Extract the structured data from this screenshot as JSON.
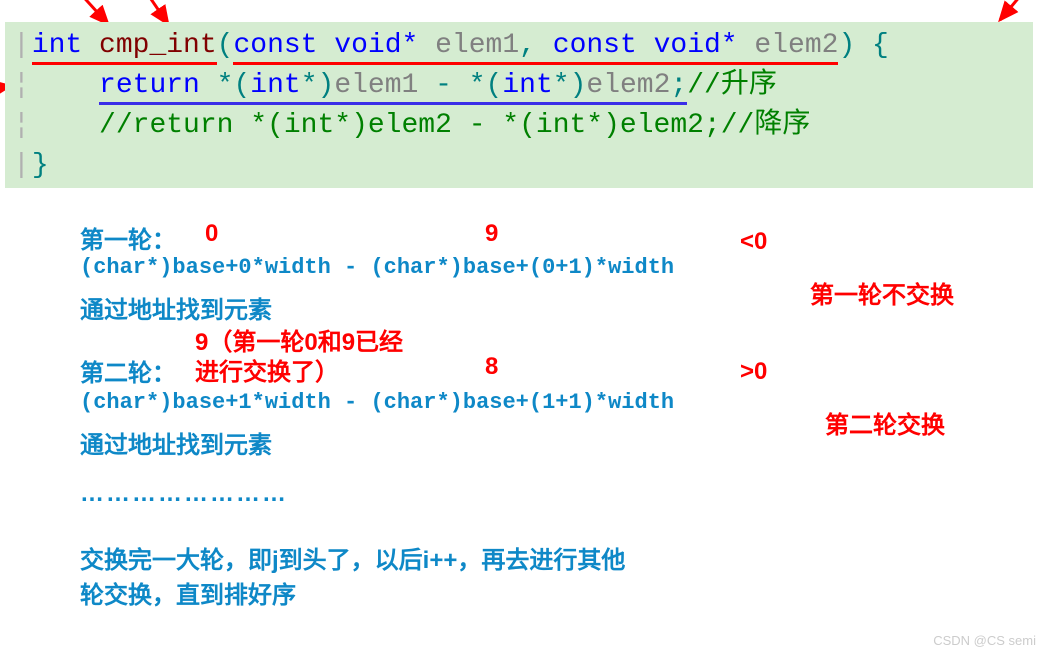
{
  "code": {
    "line1": {
      "int": "int",
      "func": " cmp_int",
      "open": "(",
      "const1": "const void",
      "star1": "*",
      "sp1": " ",
      "id1": "elem1",
      "comma": ",",
      "sp2": " ",
      "const2": "const void",
      "star2": "*",
      "sp3": " ",
      "id2": "elem2",
      "close": ")",
      "brace": " {"
    },
    "line2": {
      "indent": "    ",
      "return": "return",
      "sp1": " ",
      "star1": "*(",
      "int1": "int",
      "cast1": "*)",
      "id1": "elem1",
      "minus": " - ",
      "star2": "*(",
      "int2": "int",
      "cast2": "*)",
      "id2": "elem2",
      "semi": ";",
      "comment": "//升序"
    },
    "line3": {
      "indent": "    ",
      "comment": "//return *(int*)elem2 - *(int*)elem2;//降序"
    },
    "line4": {
      "brace": "}"
    }
  },
  "ann": {
    "r1_label": "第一轮：",
    "r1_v1": "0",
    "r1_v2": "9",
    "r1_cmp": "<0",
    "r1_expr": "(char*)base+0*width - (char*)base+(0+1)*width",
    "r1_desc": "通过地址找到元素",
    "r1_result": "第一轮不交换",
    "r2_note": "9（第一轮0和9已经进行交换了）",
    "r2_label": "第二轮：",
    "r2_v2": "8",
    "r2_cmp": ">0",
    "r2_expr": "(char*)base+1*width - (char*)base+(1+1)*width",
    "r2_desc": "通过地址找到元素",
    "r2_result": "第二轮交换",
    "dots": "……………………",
    "final1": "交换完一大轮，即j到头了，以后i++，再去进行其他",
    "final2": "轮交换，直到排好序"
  },
  "watermark": "CSDN @CS semi"
}
